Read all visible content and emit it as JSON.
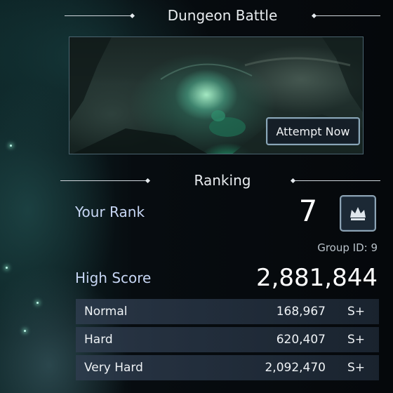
{
  "dungeon": {
    "title": "Dungeon Battle",
    "attempt_label": "Attempt Now"
  },
  "ranking": {
    "title": "Ranking",
    "your_rank_label": "Your Rank",
    "your_rank_value": "7",
    "crown_icon": "crown-icon",
    "group_id": "Group ID: 9",
    "high_score_label": "High Score",
    "high_score_value": "2,881,844",
    "difficulties": [
      {
        "name": "Normal",
        "score": "168,967",
        "grade": "S+"
      },
      {
        "name": "Hard",
        "score": "620,407",
        "grade": "S+"
      },
      {
        "name": "Very Hard",
        "score": "2,092,470",
        "grade": "S+"
      }
    ]
  },
  "colors": {
    "label_accent": "#c7d6f4",
    "button_border": "#8aa6b8"
  }
}
